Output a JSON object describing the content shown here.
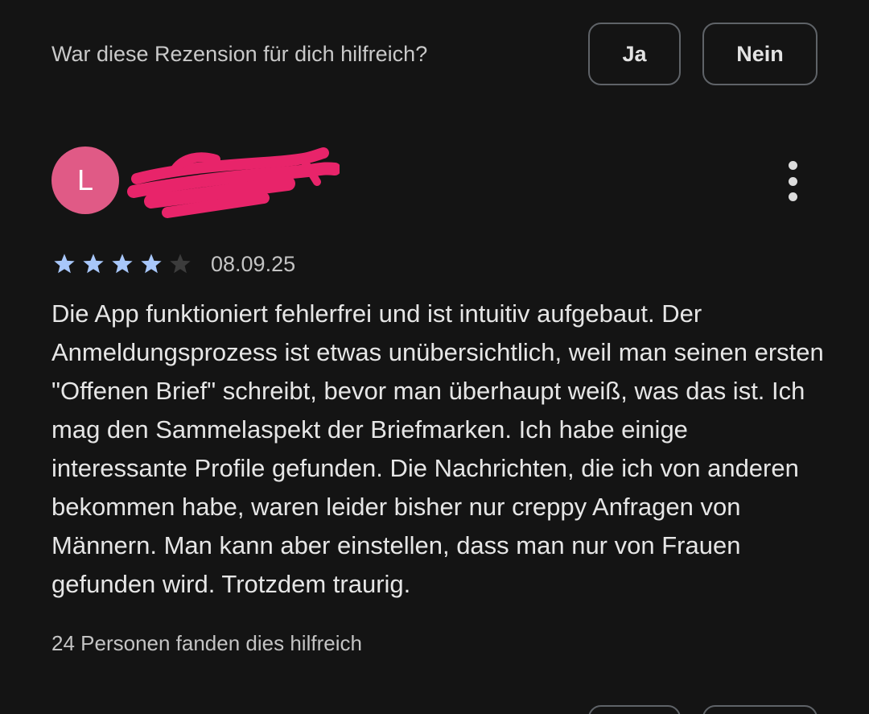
{
  "helpful_prompt": {
    "question": "War diese Rezension für dich hilfreich?",
    "yes_label": "Ja",
    "no_label": "Nein"
  },
  "review": {
    "author_initial": "L",
    "author_name_redacted": true,
    "redaction_color": "#e8246a",
    "avatar_color": "#e05a86",
    "more_icon": "more-vert-icon",
    "rating": 4,
    "rating_max": 5,
    "star_filled_color": "#a8c7fa",
    "star_empty_color": "#3c3c3c",
    "date": "08.09.25",
    "text": "Die App funktioniert fehlerfrei und ist intuitiv aufgebaut. Der Anmeldungsprozess ist etwas unübersichtlich, weil man seinen ersten \"Offenen Brief\" schreibt, bevor man überhaupt weiß, was das ist. Ich mag den Sammelaspekt der Briefmarken. Ich habe einige interessante Profile gefunden. Die Nachrichten, die ich von anderen bekommen habe, waren leider bisher nur creppy Anfragen von Männern. Man kann aber einstellen, dass man nur von Frauen gefunden wird. Trotzdem traurig.",
    "helpful_count": "24 Personen fanden dies hilfreich"
  },
  "theme": {
    "background": "#141414",
    "text_primary": "#e6e6e6",
    "text_secondary": "#c4c4c4",
    "button_border": "#5f6368"
  }
}
